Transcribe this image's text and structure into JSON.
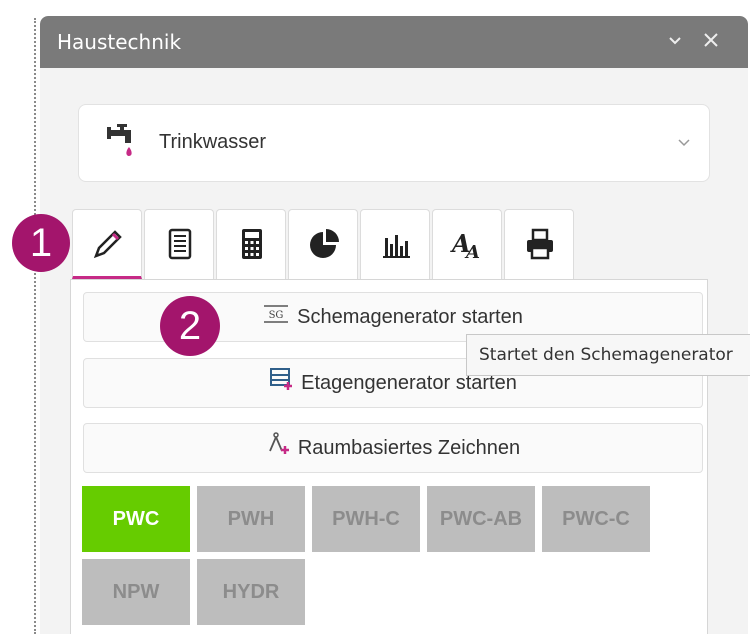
{
  "window": {
    "title": "Haustechnik",
    "minimize_icon": "chevron-down-icon",
    "close_icon": "close-icon"
  },
  "system_dropdown": {
    "selected": "Trinkwasser",
    "icon": "faucet-icon"
  },
  "tabs": [
    {
      "id": "draw",
      "icon": "pencil-icon",
      "active": true
    },
    {
      "id": "list",
      "icon": "list-icon"
    },
    {
      "id": "calc",
      "icon": "calculator-icon"
    },
    {
      "id": "pie",
      "icon": "pie-chart-icon"
    },
    {
      "id": "bars",
      "icon": "bar-chart-icon"
    },
    {
      "id": "text",
      "icon": "text-size-icon"
    },
    {
      "id": "print",
      "icon": "printer-icon"
    }
  ],
  "actions": {
    "schema": {
      "label": "Schemagenerator starten",
      "icon_text": "SG"
    },
    "etage": {
      "label": "Etagengenerator starten"
    },
    "raum": {
      "label": "Raumbasiertes Zeichnen"
    }
  },
  "filters": [
    "PWC",
    "PWH",
    "PWH-C",
    "PWC-AB",
    "PWC-C",
    "NPW",
    "HYDR"
  ],
  "active_filter": "PWC",
  "tooltip": "Startet den Schemagenerator",
  "callouts": [
    "1",
    "2"
  ],
  "colors": {
    "accent": "#c62a86",
    "active_filter": "#66cc00",
    "callout": "#a3156c"
  }
}
